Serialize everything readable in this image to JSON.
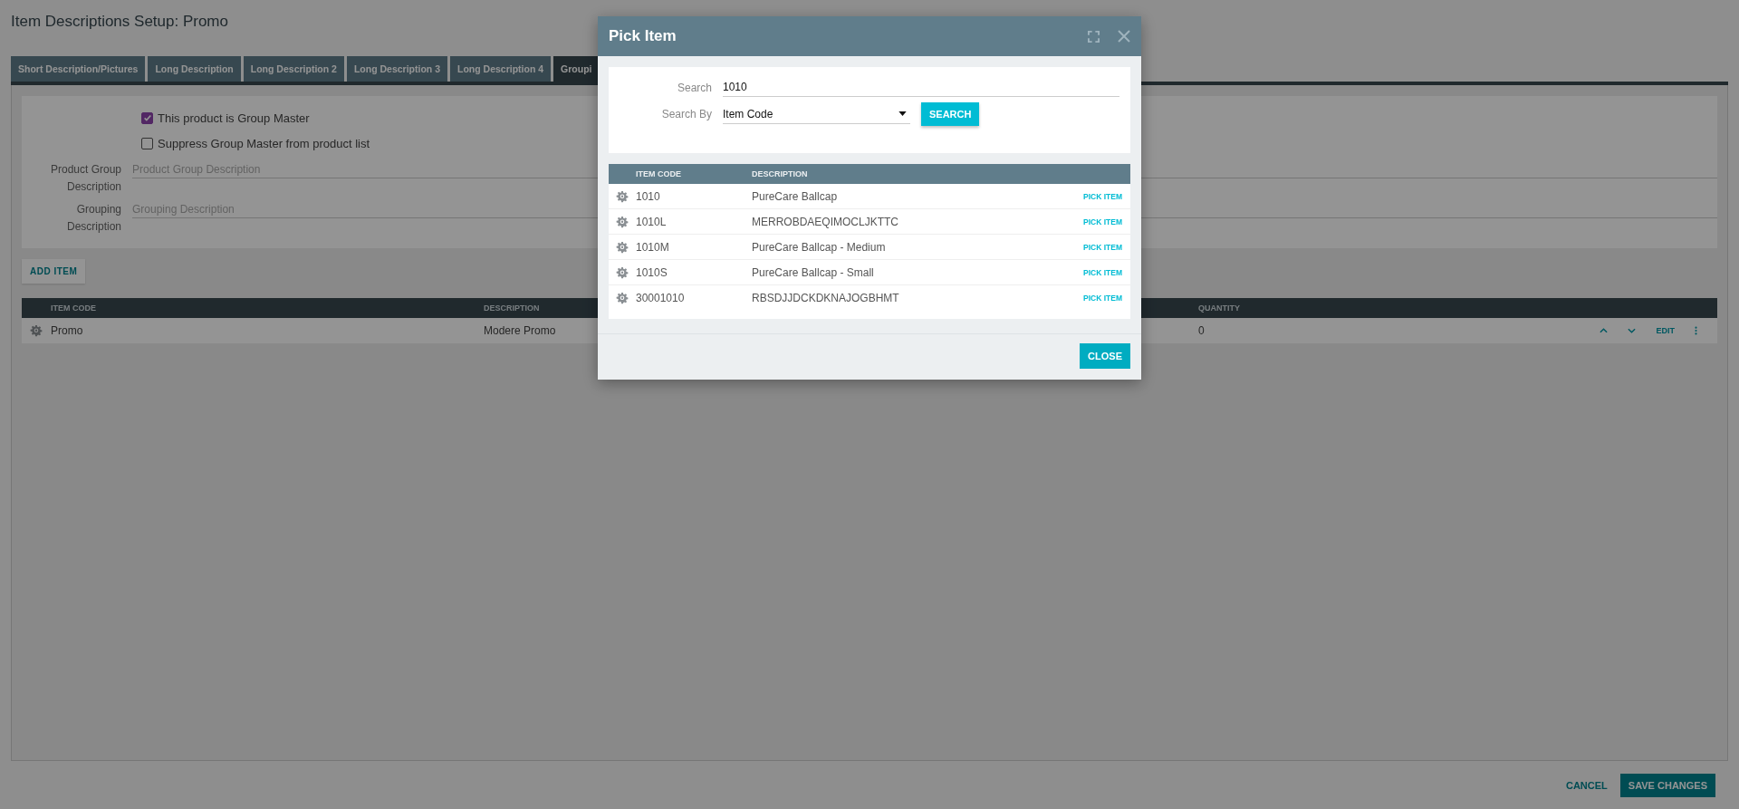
{
  "page": {
    "title": "Item Descriptions Setup: Promo"
  },
  "tabs": [
    {
      "label": "Short Description/Pictures",
      "selected": false
    },
    {
      "label": "Long Description",
      "selected": false
    },
    {
      "label": "Long Description 2",
      "selected": false
    },
    {
      "label": "Long Description 3",
      "selected": false
    },
    {
      "label": "Long Description 4",
      "selected": false
    },
    {
      "label": "Groupi",
      "selected": true
    }
  ],
  "group_form": {
    "checkboxes": [
      {
        "label": "This product is Group Master",
        "checked": true
      },
      {
        "label": "Suppress Group Master from product list",
        "checked": false
      }
    ],
    "fields": [
      {
        "label": "Product Group Description",
        "placeholder": "Product Group Description"
      },
      {
        "label": "Grouping Description",
        "placeholder": "Grouping Description"
      }
    ]
  },
  "add_item_button": "ADD ITEM",
  "items_table": {
    "columns": [
      "ITEM CODE",
      "DESCRIPTION",
      "QUANTITY"
    ],
    "rows": [
      {
        "item_code": "Promo",
        "description": "Modere Promo",
        "quantity": "0",
        "edit": "EDIT"
      }
    ]
  },
  "footer": {
    "cancel": "CANCEL",
    "save": "SAVE CHANGES"
  },
  "dialog": {
    "title": "Pick Item",
    "search_label": "Search",
    "search_value": "1010",
    "search_by_label": "Search By",
    "search_by_value": "Item Code",
    "search_button": "SEARCH",
    "columns": [
      "ITEM CODE",
      "DESCRIPTION"
    ],
    "rows": [
      {
        "item_code": "1010",
        "description": "PureCare Ballcap",
        "action": "PICK ITEM"
      },
      {
        "item_code": "1010L",
        "description": "MERROBDAEQIMOCLJKTTC",
        "action": "PICK ITEM"
      },
      {
        "item_code": "1010M",
        "description": "PureCare Ballcap - Medium",
        "action": "PICK ITEM"
      },
      {
        "item_code": "1010S",
        "description": "PureCare Ballcap - Small",
        "action": "PICK ITEM"
      },
      {
        "item_code": "30001010",
        "description": "RBSDJJDCKDKNAJOGBHMT",
        "action": "PICK ITEM"
      }
    ],
    "close_button": "CLOSE"
  }
}
